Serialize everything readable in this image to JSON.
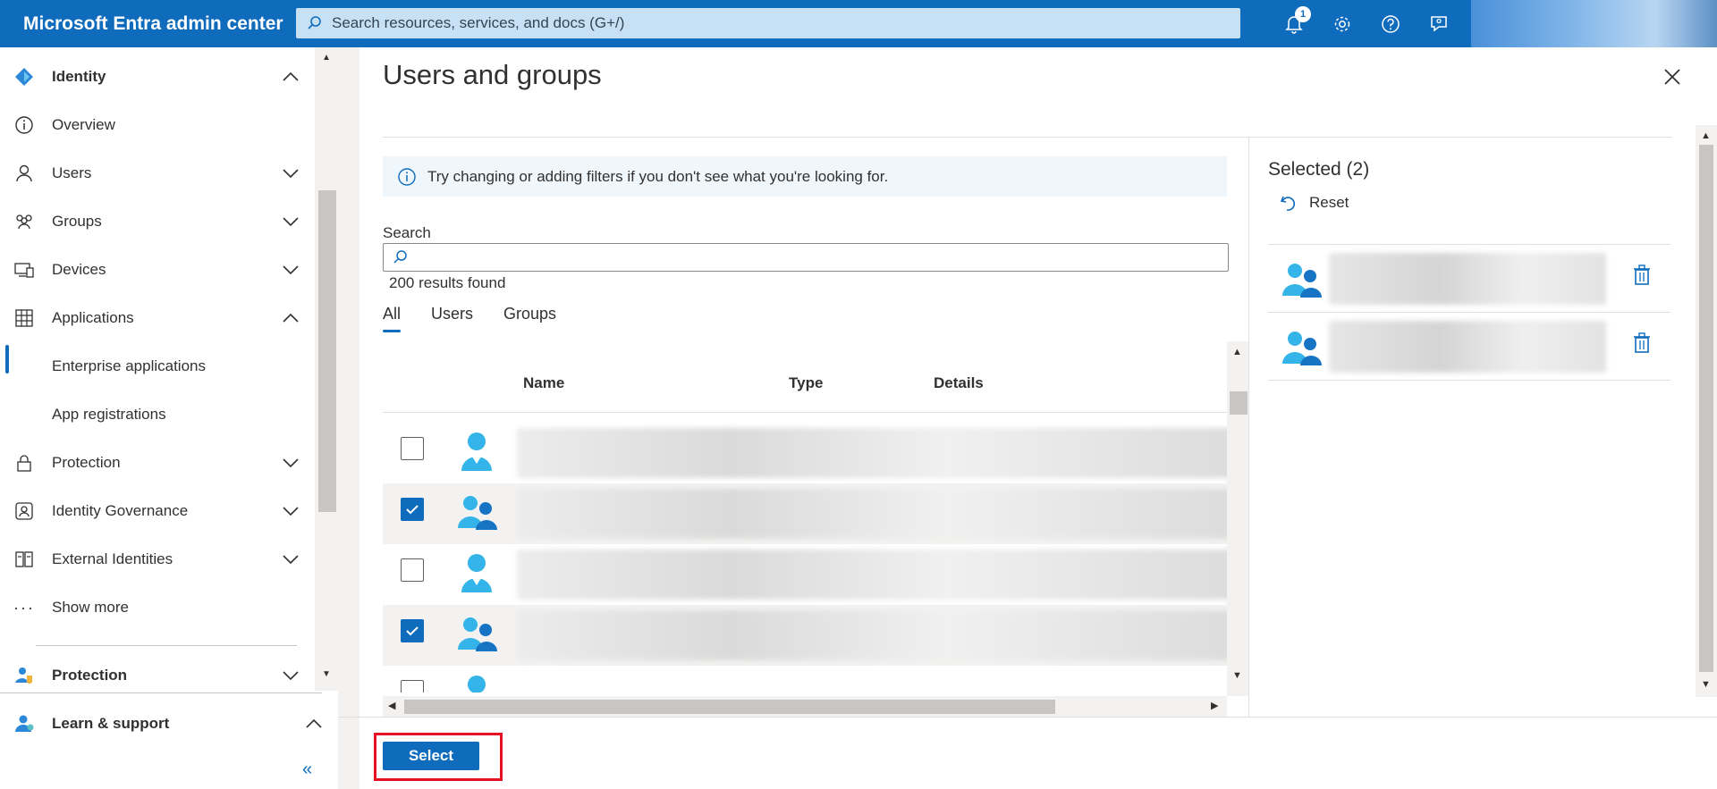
{
  "app": {
    "title": "Microsoft Entra admin center",
    "search_placeholder": "Search resources, services, and docs (G+/)",
    "notification_count": "1"
  },
  "sidebar": {
    "items": [
      {
        "label": "Identity",
        "icon": "identity-diamond-icon",
        "chevron": "up"
      },
      {
        "label": "Overview",
        "icon": "info-icon"
      },
      {
        "label": "Users",
        "icon": "user-icon",
        "chevron": "down"
      },
      {
        "label": "Groups",
        "icon": "groups-icon",
        "chevron": "down"
      },
      {
        "label": "Devices",
        "icon": "devices-icon",
        "chevron": "down"
      },
      {
        "label": "Applications",
        "icon": "applications-icon",
        "chevron": "up"
      },
      {
        "label": "Enterprise applications"
      },
      {
        "label": "App registrations"
      },
      {
        "label": "Protection",
        "icon": "lock-icon",
        "chevron": "down"
      },
      {
        "label": "Identity Governance",
        "icon": "governance-icon",
        "chevron": "down"
      },
      {
        "label": "External Identities",
        "icon": "external-identities-icon",
        "chevron": "down"
      },
      {
        "label": "Show more",
        "icon": "more-icon"
      },
      {
        "label": "Protection",
        "icon": "protection-user-icon",
        "chevron": "down"
      },
      {
        "label": "Learn & support",
        "icon": "learn-support-icon",
        "chevron": "up"
      }
    ],
    "collapse_glyph": "«"
  },
  "panel": {
    "title": "Users and groups",
    "info_text": "Try changing or adding filters if you don't see what you're looking for.",
    "search_label": "Search",
    "search_value": "",
    "results_text": "200 results found",
    "tabs": [
      "All",
      "Users",
      "Groups"
    ],
    "active_tab": "All",
    "columns": [
      "Name",
      "Type",
      "Details"
    ],
    "rows": [
      {
        "kind": "user",
        "checked": false
      },
      {
        "kind": "group",
        "checked": true
      },
      {
        "kind": "user",
        "checked": false
      },
      {
        "kind": "group",
        "checked": true
      }
    ],
    "selected_header": "Selected (2)",
    "reset_label": "Reset",
    "select_button": "Select"
  },
  "colors": {
    "brand": "#0f6cbd",
    "highlight": "#e81123"
  }
}
